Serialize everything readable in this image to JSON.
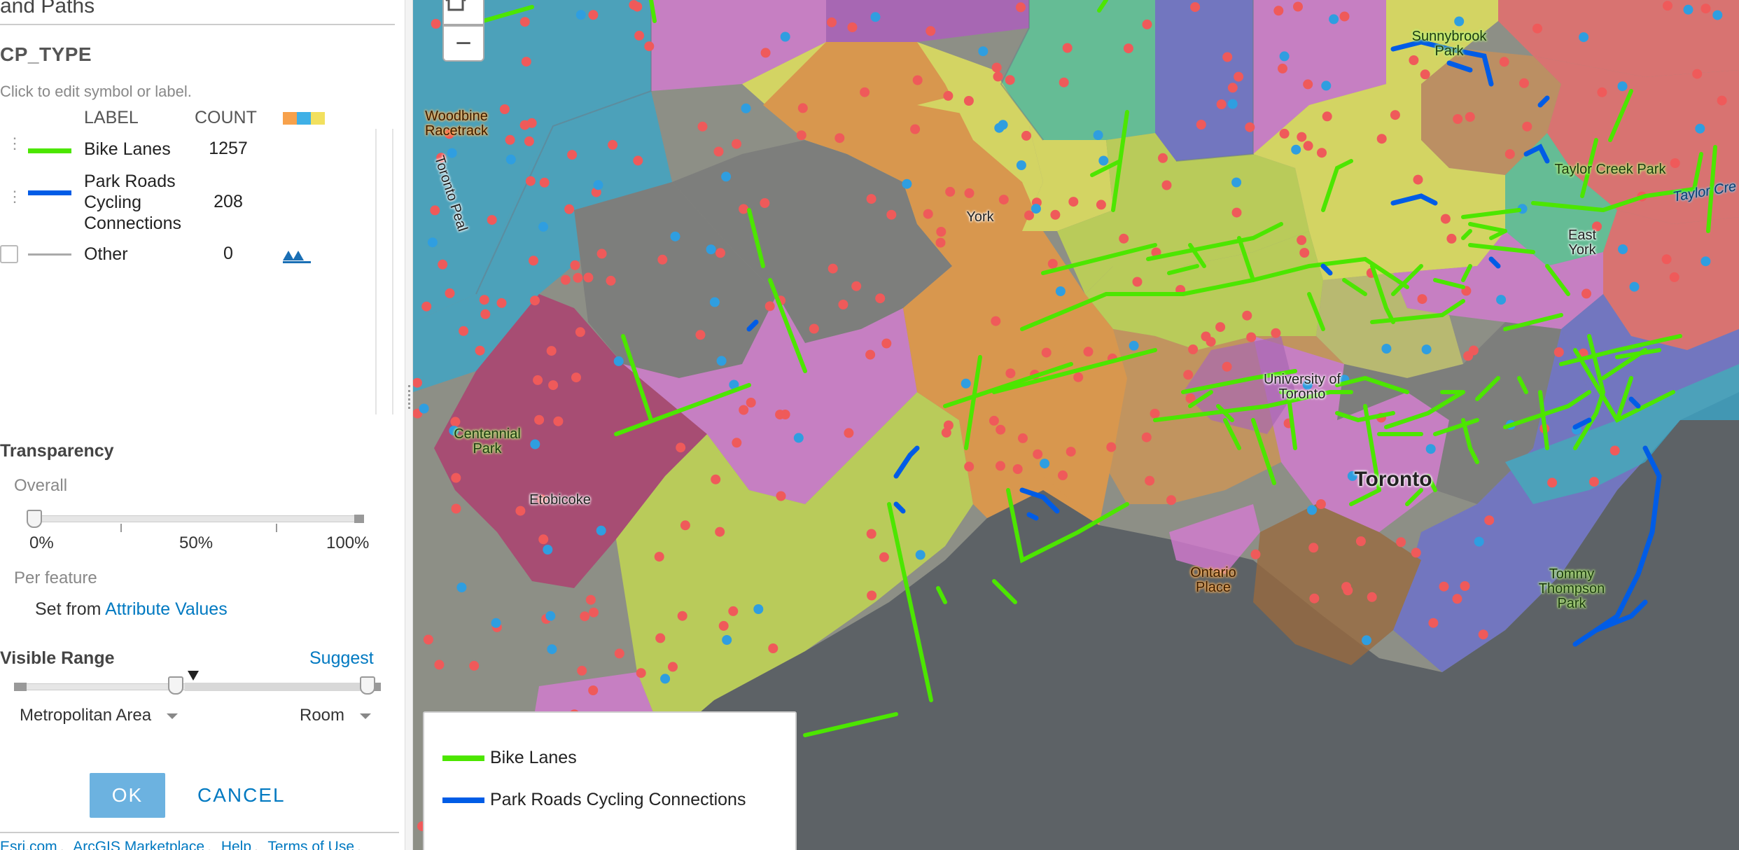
{
  "panel": {
    "title": "and Paths",
    "field": "CP_TYPE",
    "hint": "Click to edit symbol or label.",
    "col_label": "LABEL",
    "col_count": "COUNT",
    "ramp_colors": [
      "#f7a14b",
      "#3fb0e6",
      "#f2e05e"
    ],
    "rows": [
      {
        "label": "Bike Lanes",
        "count": "1257",
        "color": "#4ce600"
      },
      {
        "label": "Park Roads Cycling Connections",
        "count": "208",
        "color": "#005ce6"
      },
      {
        "label": "Other",
        "count": "0",
        "color": "#aaaaaa"
      }
    ],
    "transparency": {
      "title": "Transparency",
      "overall_label": "Overall",
      "value_percent": 0,
      "ticks": [
        "0%",
        "50%",
        "100%"
      ],
      "per_feature_label": "Per feature",
      "set_from_prefix": "Set from",
      "set_from_link": "Attribute Values"
    },
    "visible_range": {
      "title": "Visible Range",
      "suggest": "Suggest",
      "min_label": "Metropolitan Area",
      "max_label": "Room"
    },
    "ok": "OK",
    "cancel": "CANCEL",
    "footer": [
      "Esri.com",
      "ArcGIS Marketplace",
      "Help",
      "Terms of Use"
    ]
  },
  "map": {
    "zoom_out": "−",
    "places": {
      "woodbine": "Woodbine Racetrack",
      "toronto_pearson": "Toronto Peal",
      "york": "York",
      "sunnybrook": "Sunnybrook Park",
      "taylor_creek": "Taylor Creek Park",
      "taylor_creek_water": "Taylor Cre",
      "east_york": "East York",
      "centennial": "Centennial Park",
      "etobicoke": "Etobicoke",
      "uoft": "University of Toronto",
      "toronto": "Toronto",
      "ontario_place": "Ontario Place",
      "tommy_thompson": "Tommy Thompson Park"
    },
    "legend": [
      {
        "label": "Bike Lanes",
        "color": "#4ce600"
      },
      {
        "label": "Park Roads Cycling Connections",
        "color": "#005ce6"
      }
    ]
  }
}
